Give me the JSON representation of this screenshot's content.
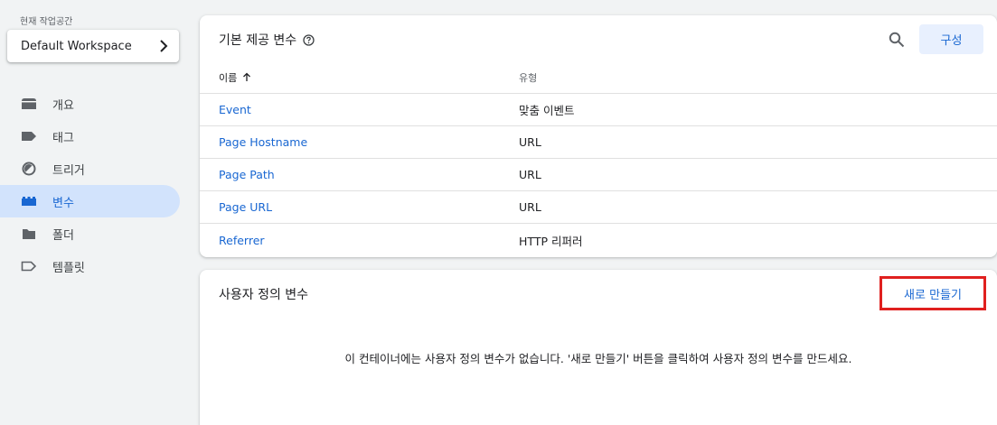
{
  "sidebar": {
    "workspace_label": "현재 작업공간",
    "workspace_name": "Default Workspace",
    "items": [
      {
        "label": "개요",
        "icon": "overview-icon"
      },
      {
        "label": "태그",
        "icon": "tag-icon"
      },
      {
        "label": "트리거",
        "icon": "trigger-icon"
      },
      {
        "label": "변수",
        "icon": "variables-icon",
        "active": true
      },
      {
        "label": "폴더",
        "icon": "folder-icon"
      },
      {
        "label": "템플릿",
        "icon": "template-icon"
      }
    ]
  },
  "builtin": {
    "title": "기본 제공 변수",
    "config_label": "구성",
    "columns": {
      "name": "이름",
      "type": "유형"
    },
    "rows": [
      {
        "name": "Event",
        "type": "맞춤 이벤트"
      },
      {
        "name": "Page Hostname",
        "type": "URL"
      },
      {
        "name": "Page Path",
        "type": "URL"
      },
      {
        "name": "Page URL",
        "type": "URL"
      },
      {
        "name": "Referrer",
        "type": "HTTP 리퍼러"
      }
    ]
  },
  "user_defined": {
    "title": "사용자 정의 변수",
    "new_label": "새로 만들기",
    "empty_message": "이 컨테이너에는 사용자 정의 변수가 없습니다. '새로 만들기' 버튼을 클릭하여 사용자 정의 변수를 만드세요."
  },
  "colors": {
    "accent": "#1967d2",
    "active_bg": "#d2e3fc",
    "highlight_border": "#e0201f"
  }
}
